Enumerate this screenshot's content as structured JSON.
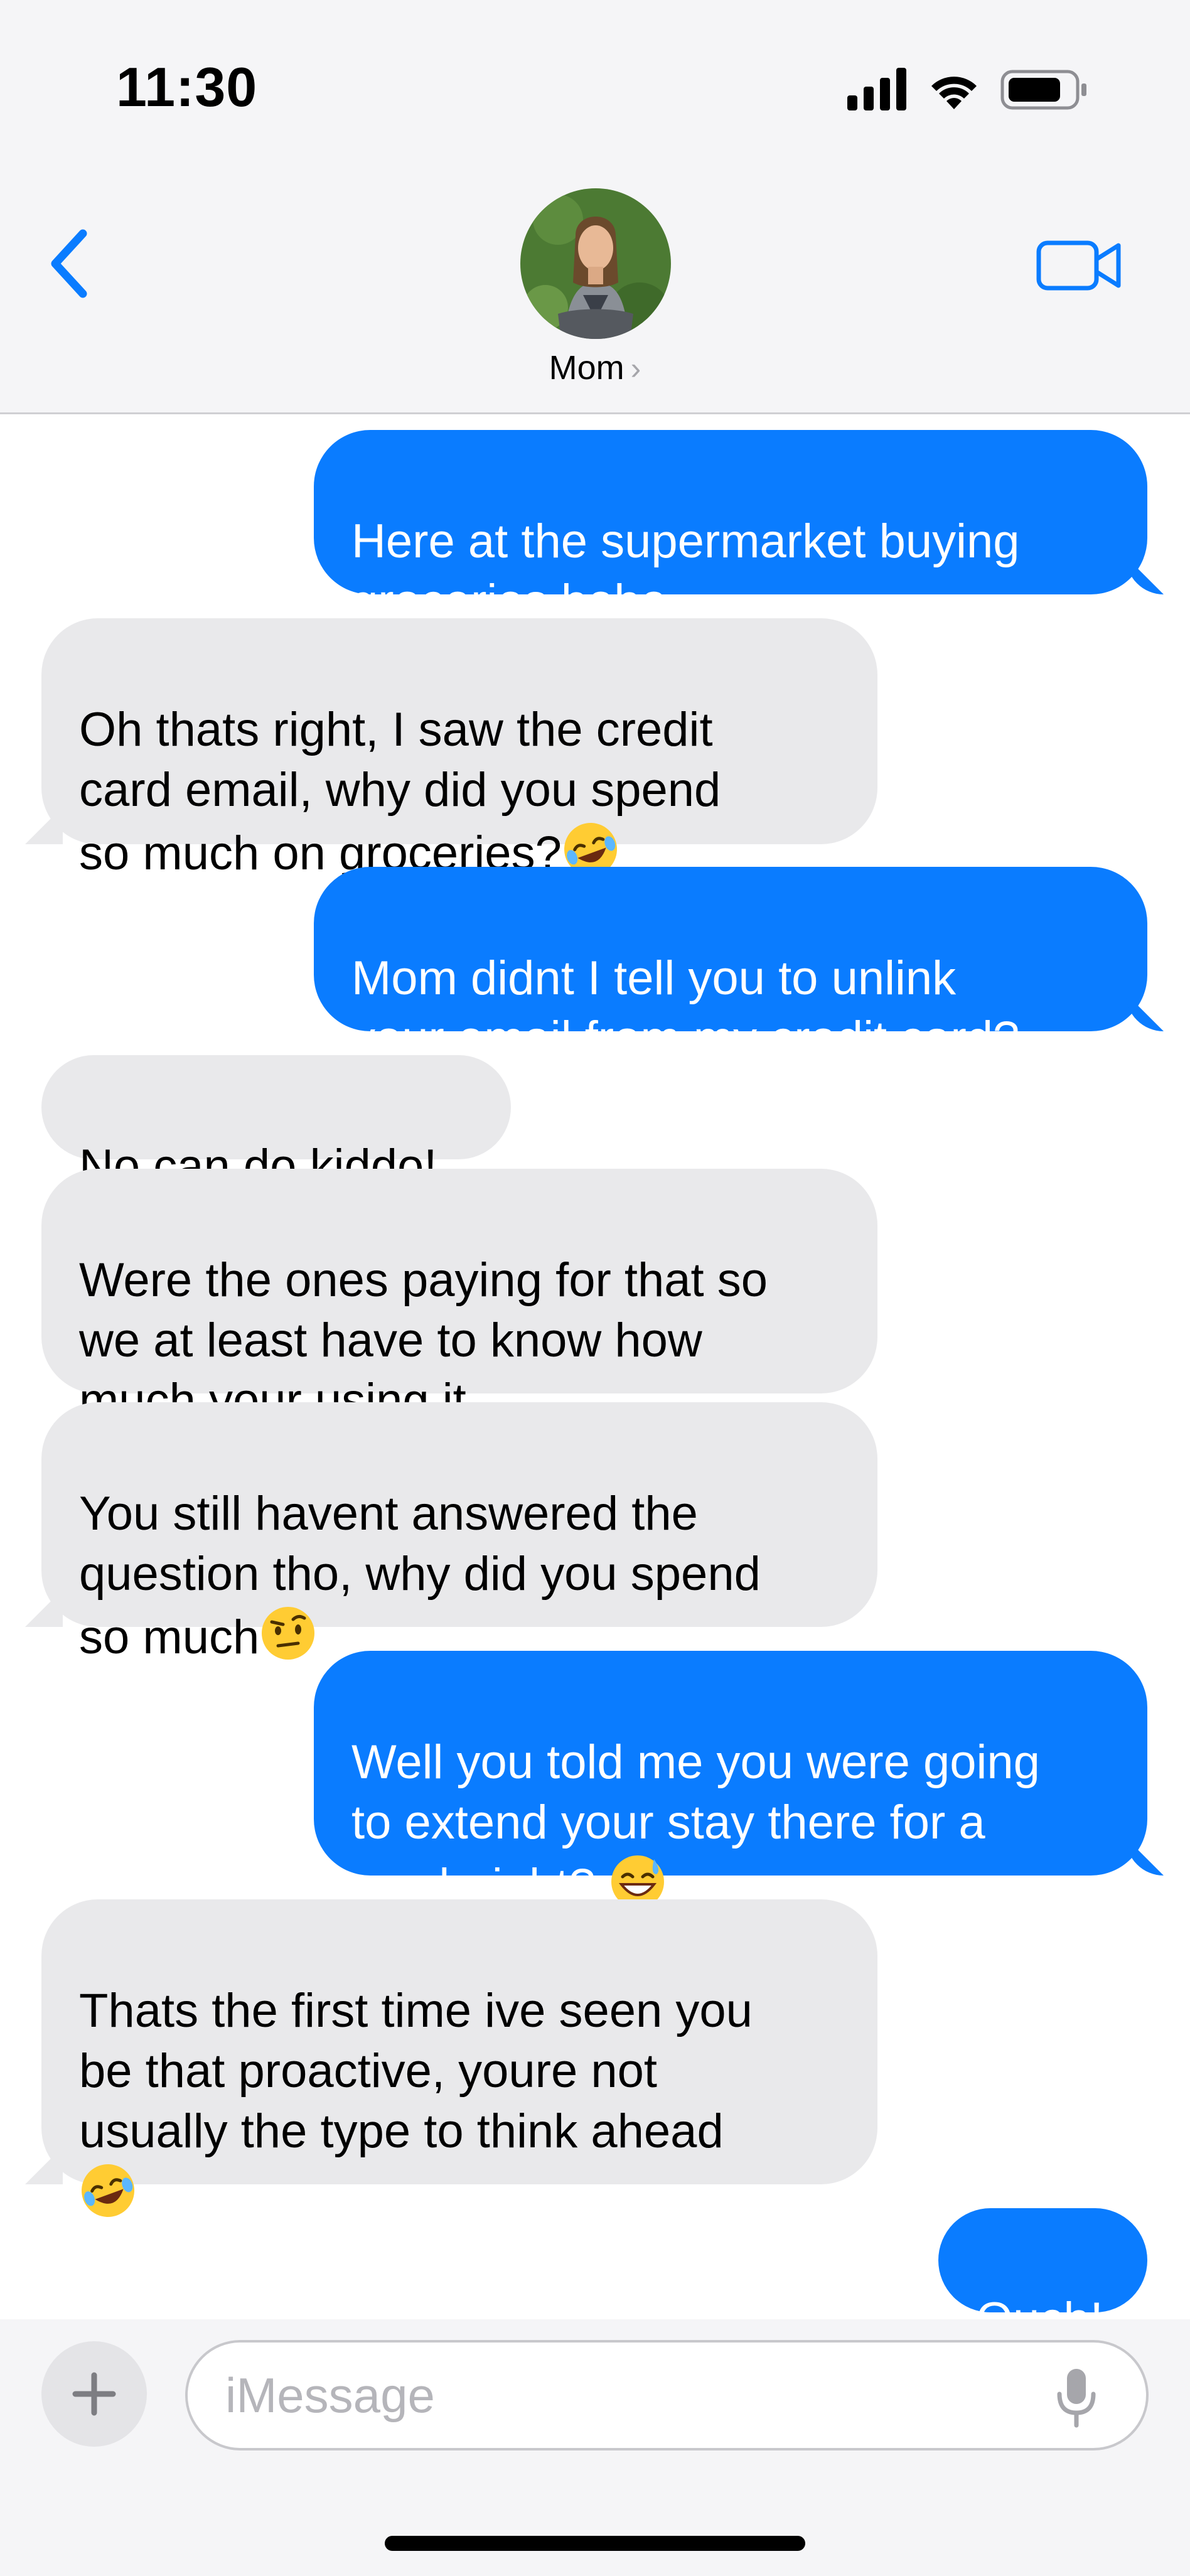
{
  "status_bar": {
    "time": "11:30"
  },
  "header": {
    "contact_name": "Mom",
    "chevron": "›",
    "icons": {
      "back": "chevron-left-icon",
      "video": "video-camera-icon"
    }
  },
  "colors": {
    "outgoing_bubble": "#0a7cff",
    "incoming_bubble": "#e9e9eb",
    "accent": "#0a7cff"
  },
  "messages": [
    {
      "direction": "out",
      "text": "Here at the supermarket buying\ngroceries hehe"
    },
    {
      "direction": "in",
      "text": "Oh thats right, I saw the credit\ncard email, why did you spend\nso much on groceries?",
      "emoji": "rolling-on-floor-laughing"
    },
    {
      "direction": "out",
      "text": "Mom didnt I tell you to unlink\nyour email from my credit card?"
    },
    {
      "direction": "in",
      "text": "No can do kiddo!"
    },
    {
      "direction": "in",
      "text": "Were the ones paying for that so\nwe at least have to know how\nmuch your using it"
    },
    {
      "direction": "in",
      "text": "You still havent answered the\nquestion tho, why did you spend\nso much",
      "emoji": "face-with-raised-eyebrow"
    },
    {
      "direction": "out",
      "text": "Well you told me you were going\nto extend your stay there for a\nweek right? ",
      "emoji": "grinning-face-with-sweat"
    },
    {
      "direction": "in",
      "text": "Thats the first time ive seen you\nbe that proactive, youre not\nusually the type to think ahead\n",
      "emoji": "rolling-on-floor-laughing"
    },
    {
      "direction": "out",
      "text": "Ouch!"
    }
  ],
  "composer": {
    "placeholder": "iMessage",
    "plus_label": "+"
  }
}
